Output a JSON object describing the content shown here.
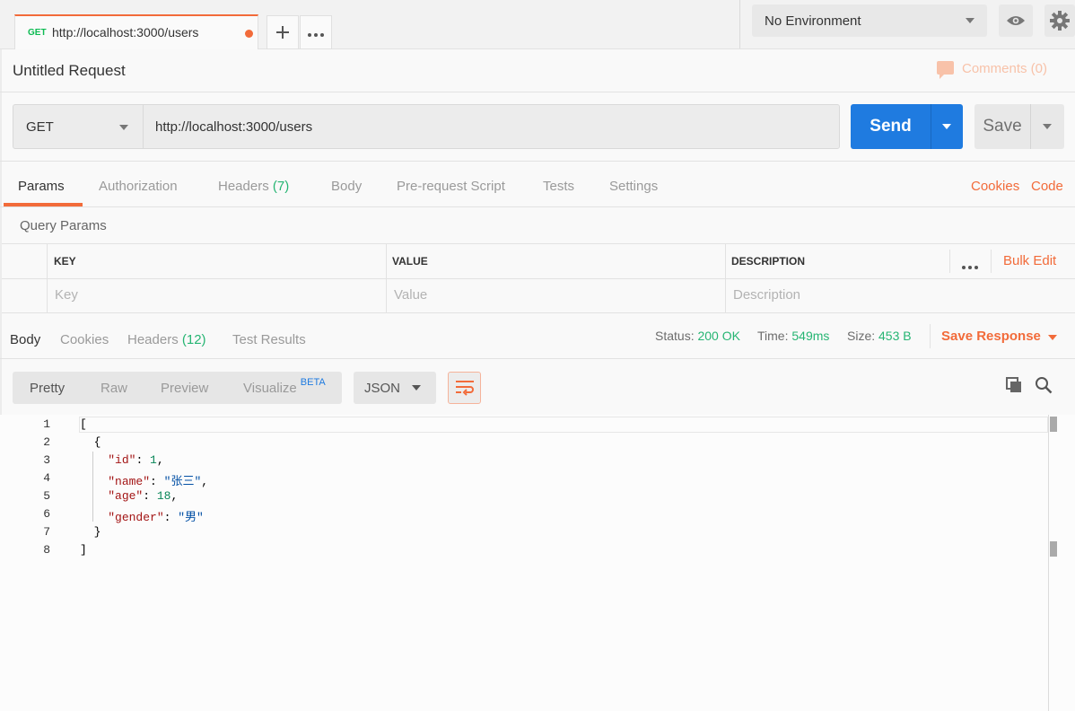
{
  "tabs": [
    {
      "method": "GET",
      "title": "http://localhost:3000/users",
      "unsaved": true
    }
  ],
  "tab_actions": {
    "new_tab_icon": "plus-icon",
    "more_icon": "ellipsis-icon"
  },
  "environment": {
    "selected": "No Environment",
    "quick_look_icon": "eye-icon",
    "settings_icon": "gear-icon"
  },
  "request": {
    "title": "Untitled Request",
    "comments_label": "Comments (0)",
    "method": "GET",
    "url": "http://localhost:3000/users",
    "send_label": "Send",
    "save_label": "Save"
  },
  "request_tabs": {
    "params": "Params",
    "authorization": "Authorization",
    "headers": "Headers",
    "headers_count": "(7)",
    "body": "Body",
    "pre_request": "Pre-request Script",
    "tests": "Tests",
    "settings": "Settings",
    "cookies": "Cookies",
    "code": "Code"
  },
  "query_params": {
    "title": "Query Params",
    "columns": [
      "KEY",
      "VALUE",
      "DESCRIPTION"
    ],
    "bulk_edit": "Bulk Edit",
    "placeholders": [
      "Key",
      "Value",
      "Description"
    ]
  },
  "response": {
    "tabs": {
      "body": "Body",
      "cookies": "Cookies",
      "headers": "Headers",
      "headers_count": "(12)",
      "test_results": "Test Results"
    },
    "status_label": "Status:",
    "status": "200 OK",
    "time_label": "Time:",
    "time": "549ms",
    "size_label": "Size:",
    "size": "453 B",
    "save_response": "Save Response",
    "formats": {
      "pretty": "Pretty",
      "raw": "Raw",
      "preview": "Preview",
      "visualize": "Visualize",
      "beta": "BETA"
    },
    "language": "JSON",
    "colors": {
      "accent": "#f26b3a",
      "send": "#1f7be0",
      "success": "#26b573"
    }
  },
  "code": {
    "line_numbers": [
      "1",
      "2",
      "3",
      "4",
      "5",
      "6",
      "7",
      "8"
    ],
    "lines": [
      {
        "parts": [
          {
            "t": "[",
            "c": "p"
          }
        ]
      },
      {
        "parts": [
          {
            "t": "  {",
            "c": "p"
          }
        ]
      },
      {
        "parts": [
          {
            "t": "    ",
            "c": "p"
          },
          {
            "t": "\"id\"",
            "c": "key"
          },
          {
            "t": ": ",
            "c": "p"
          },
          {
            "t": "1",
            "c": "num"
          },
          {
            "t": ",",
            "c": "p"
          }
        ]
      },
      {
        "parts": [
          {
            "t": "    ",
            "c": "p"
          },
          {
            "t": "\"name\"",
            "c": "key"
          },
          {
            "t": ": ",
            "c": "p"
          },
          {
            "t": "\"张三\"",
            "c": "str"
          },
          {
            "t": ",",
            "c": "p"
          }
        ]
      },
      {
        "parts": [
          {
            "t": "    ",
            "c": "p"
          },
          {
            "t": "\"age\"",
            "c": "key"
          },
          {
            "t": ": ",
            "c": "p"
          },
          {
            "t": "18",
            "c": "num"
          },
          {
            "t": ",",
            "c": "p"
          }
        ]
      },
      {
        "parts": [
          {
            "t": "    ",
            "c": "p"
          },
          {
            "t": "\"gender\"",
            "c": "key"
          },
          {
            "t": ": ",
            "c": "p"
          },
          {
            "t": "\"男\"",
            "c": "str"
          }
        ]
      },
      {
        "parts": [
          {
            "t": "  }",
            "c": "p"
          }
        ]
      },
      {
        "parts": [
          {
            "t": "]",
            "c": "p"
          }
        ]
      }
    ]
  }
}
